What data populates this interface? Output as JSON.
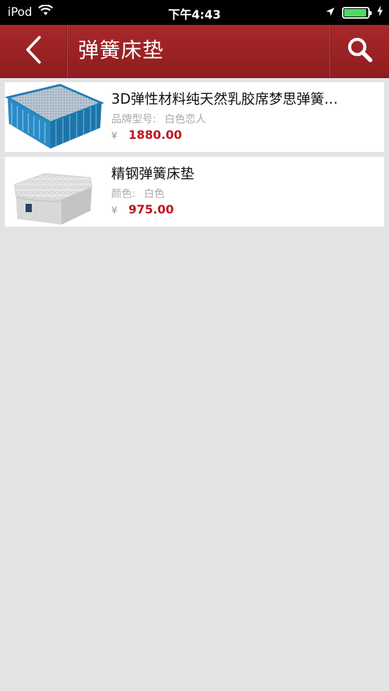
{
  "status_bar": {
    "carrier": "iPod",
    "time": "下午4:43",
    "battery_level": 0.95,
    "icons": [
      "wifi-icon",
      "location-arrow-icon",
      "battery-icon",
      "charging-icon"
    ]
  },
  "header": {
    "title": "弹簧床垫",
    "back_icon": "chevron-left-icon",
    "search_icon": "search-icon",
    "bg_color": "#9c2224"
  },
  "products": [
    {
      "name": "3D弹性材料纯天然乳胶席梦思弹簧…",
      "attr_label": "品牌型号:",
      "attr_value": "白色恋人",
      "currency": "¥",
      "price": "1880.00",
      "thumb": "blue-mattress-image"
    },
    {
      "name": "精钢弹簧床垫",
      "attr_label": "颜色:",
      "attr_value": "白色",
      "currency": "¥",
      "price": "975.00",
      "thumb": "white-mattress-image"
    }
  ],
  "colors": {
    "header": "#9c2224",
    "price": "#c0161e",
    "background": "#e3e3e5",
    "battery": "#4cd964"
  }
}
